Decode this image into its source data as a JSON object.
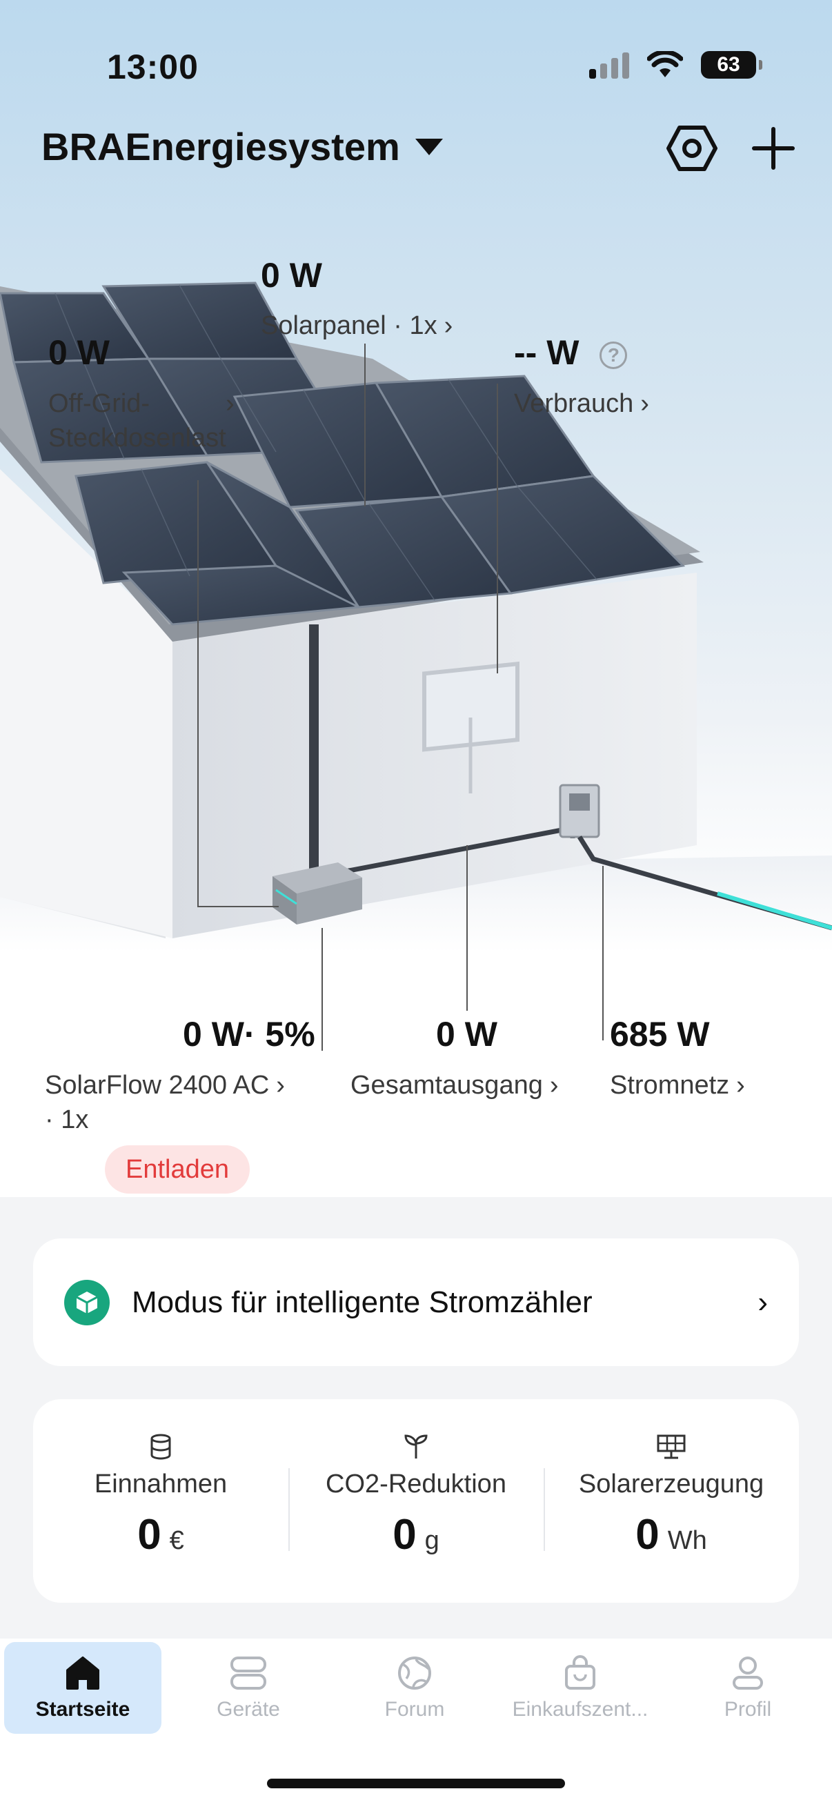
{
  "status_bar": {
    "time": "13:00",
    "battery": "63"
  },
  "header": {
    "system_name": "BRAEnergiesystem"
  },
  "flows": {
    "solar": {
      "value": "0 W",
      "label": "Solarpanel · 1x"
    },
    "offgrid": {
      "value": "0 W",
      "label_line1": "Off-Grid-",
      "label_line2": "Steckdosenlast"
    },
    "consumption": {
      "value": "-- W",
      "label": "Verbrauch"
    },
    "solarflow": {
      "value": "0 W· 5%",
      "label_line1": "SolarFlow 2400 AC",
      "label_line2": "· 1x",
      "status": "Entladen"
    },
    "total_output": {
      "value": "0 W",
      "label": "Gesamtausgang"
    },
    "grid": {
      "value": "685 W",
      "label": "Stromnetz"
    }
  },
  "mode_card": {
    "label": "Modus für intelligente Stromzähler"
  },
  "stats": [
    {
      "icon": "database-icon",
      "label": "Einnahmen",
      "value": "0",
      "unit": "€"
    },
    {
      "icon": "sprout-icon",
      "label": "CO2-Reduktion",
      "value": "0",
      "unit": "g"
    },
    {
      "icon": "solar-panel-icon",
      "label": "Solarerzeugung",
      "value": "0",
      "unit": "Wh"
    }
  ],
  "tabs": [
    {
      "label": "Startseite",
      "icon": "home-icon",
      "active": true
    },
    {
      "label": "Geräte",
      "icon": "devices-icon",
      "active": false
    },
    {
      "label": "Forum",
      "icon": "globe-icon",
      "active": false
    },
    {
      "label": "Einkaufszent...",
      "icon": "shopping-bag-icon",
      "active": false
    },
    {
      "label": "Profil",
      "icon": "person-icon",
      "active": false
    }
  ],
  "colors": {
    "accent_teal": "#18a67e",
    "active_tab_bg": "#d5e8fb",
    "discharge_red": "#e23b3b",
    "grid_flow": "#3fe0d8"
  }
}
